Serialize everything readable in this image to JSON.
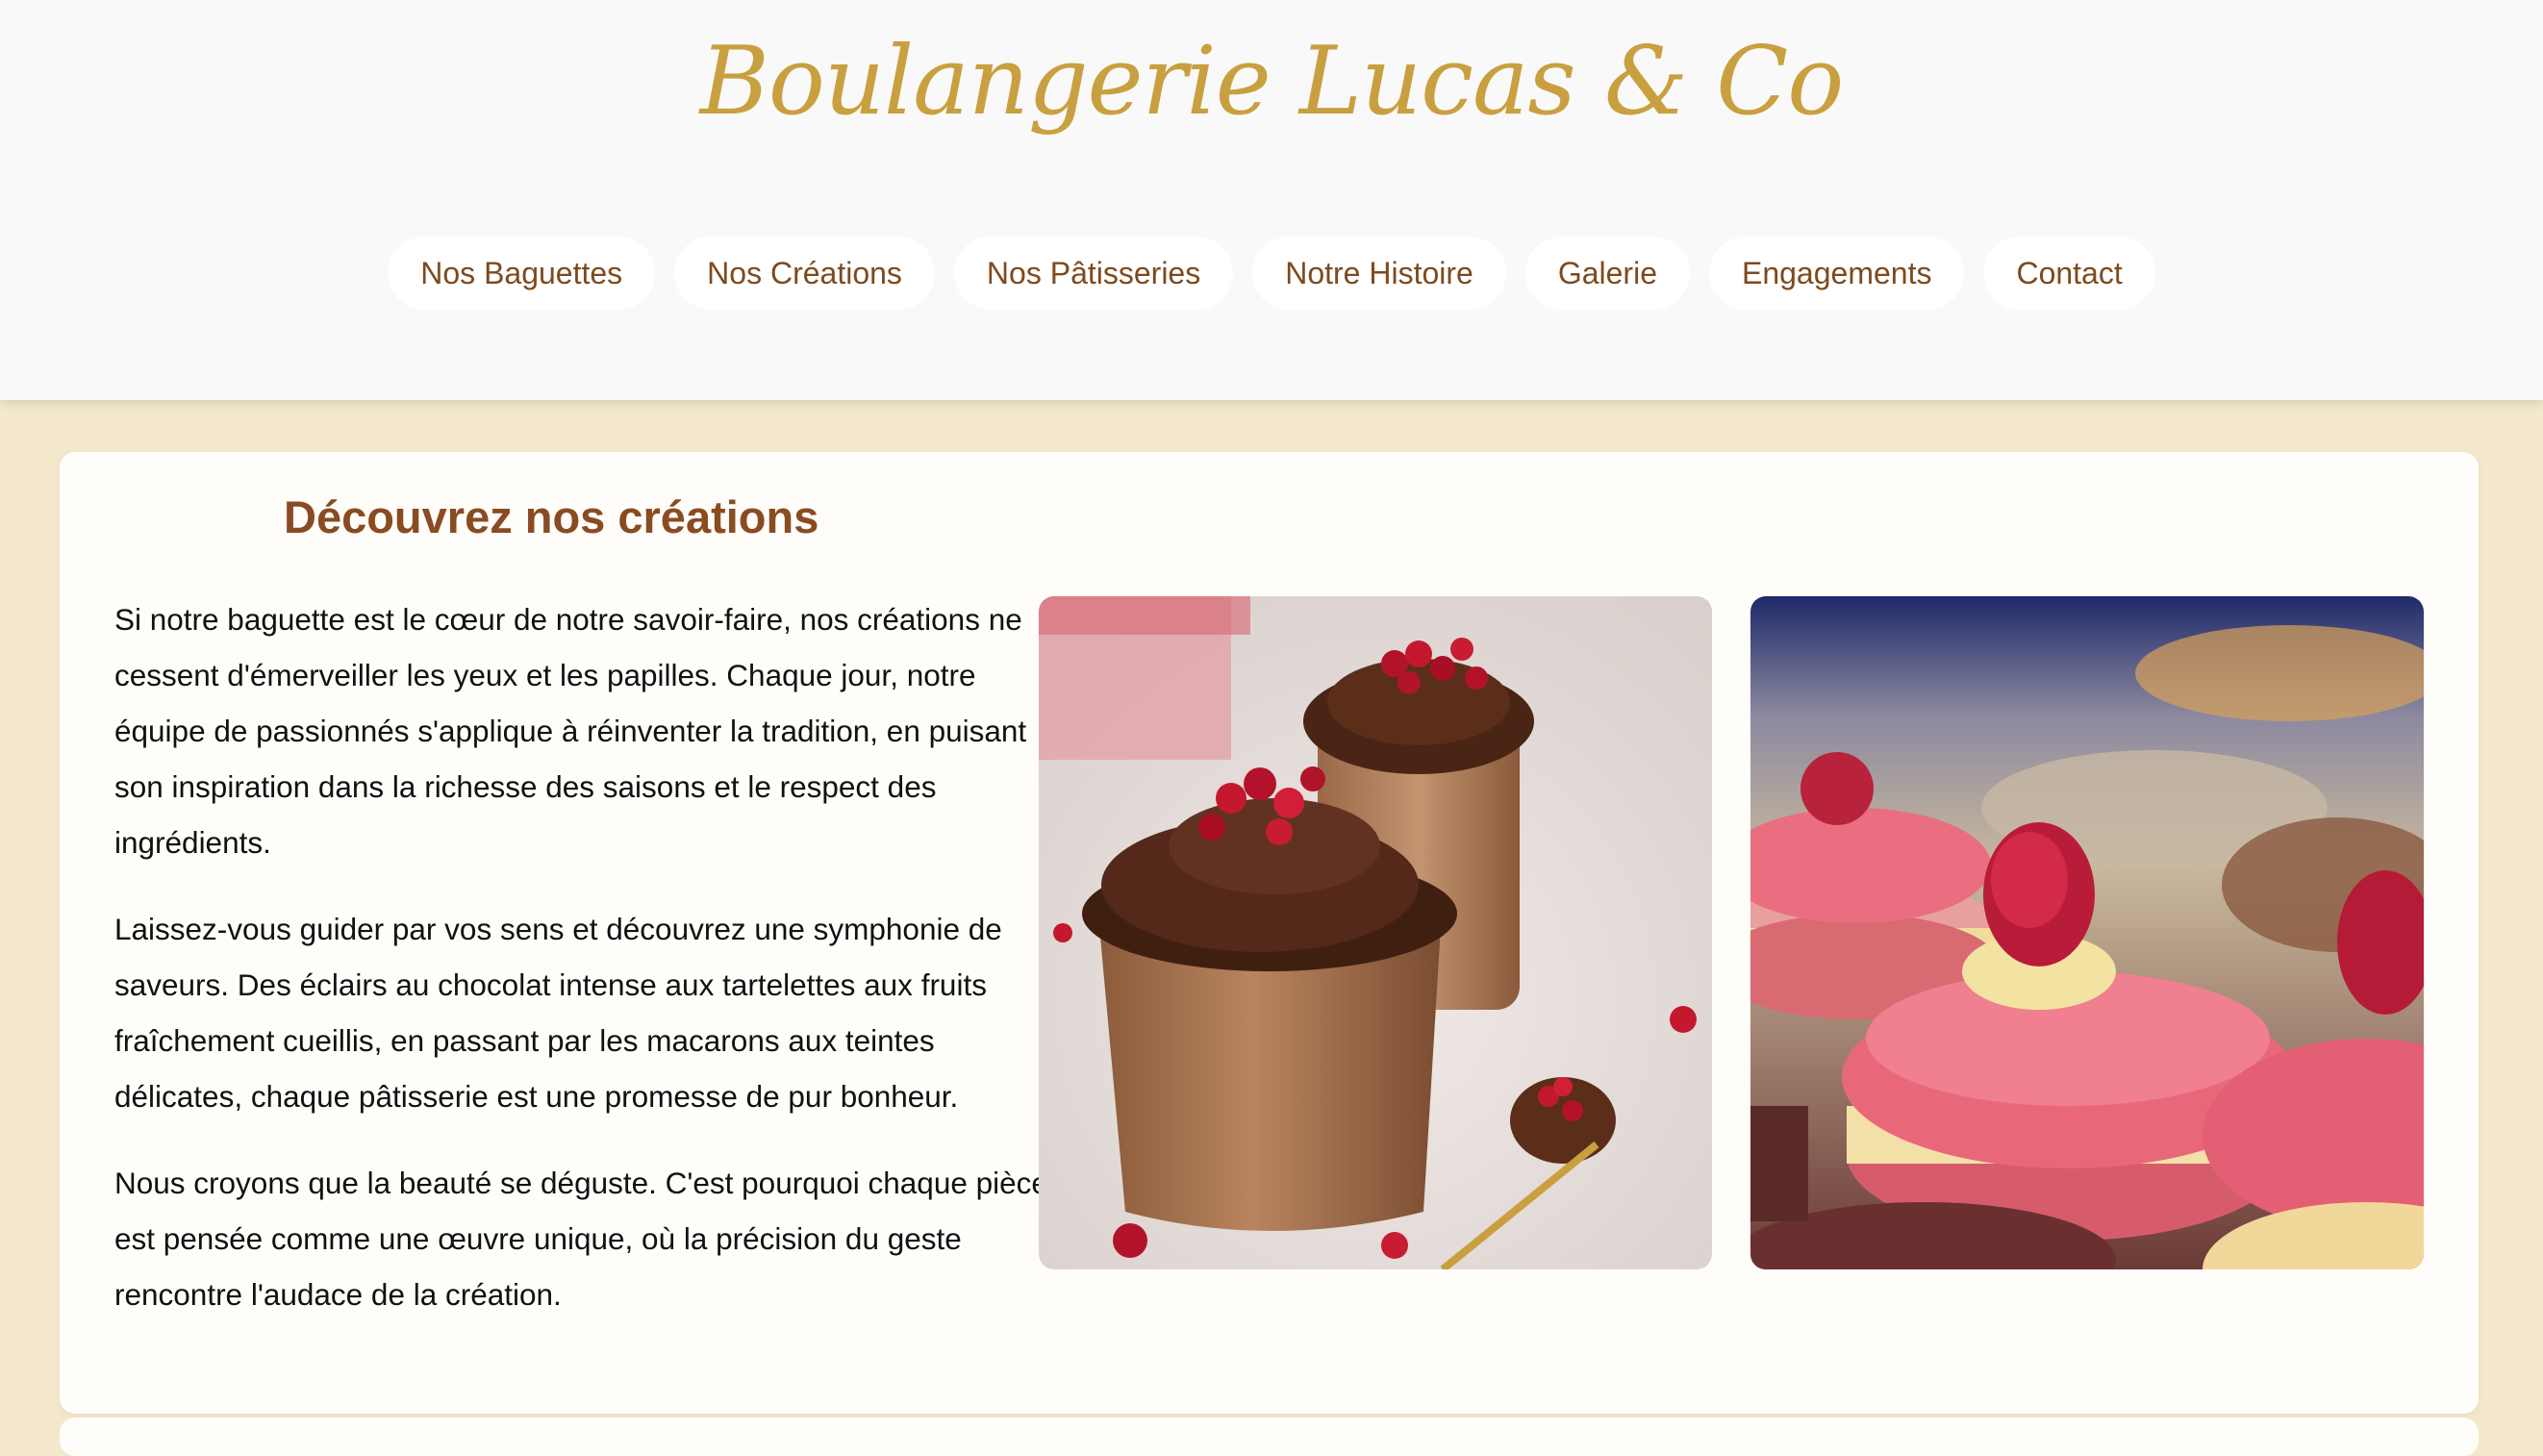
{
  "header": {
    "title": "Boulangerie Lucas & Co"
  },
  "nav": {
    "items": [
      {
        "label": "Nos Baguettes"
      },
      {
        "label": "Nos Créations"
      },
      {
        "label": "Nos Pâtisseries"
      },
      {
        "label": "Notre Histoire"
      },
      {
        "label": "Galerie"
      },
      {
        "label": "Engagements"
      },
      {
        "label": "Contact"
      }
    ]
  },
  "main": {
    "heading": "Découvrez nos créations",
    "paragraphs": [
      "Si notre baguette est le cœur de notre savoir-faire, nos créations ne cessent d'émerveiller les yeux et les papilles. Chaque jour, notre équipe de passionnés s'applique à réinventer la tradition, en puisant son inspiration dans la richesse des saisons et le respect des ingrédients.",
      "Laissez-vous guider par vos sens et découvrez une symphonie de saveurs. Des éclairs au chocolat intense aux tartelettes aux fruits fraîchement cueillis, en passant par les macarons aux teintes délicates, chaque pâtisserie est une promesse de pur bonheur.",
      "Nous croyons que la beauté se déguste. C'est pourquoi chaque pièce est pensée comme une œuvre unique, où la précision du geste rencontre l'audace de la création."
    ],
    "images": [
      {
        "subject": "chocolate-mousse-pomegranate"
      },
      {
        "subject": "raspberry-macarons"
      }
    ]
  },
  "colors": {
    "page_bg": "#f3e8cb",
    "header_bg": "#f9f9f9",
    "title_gold": "#c9a03f",
    "nav_text": "#7d4a1e",
    "heading_brown": "#8a4b22",
    "card_bg": "#fefdf9"
  }
}
